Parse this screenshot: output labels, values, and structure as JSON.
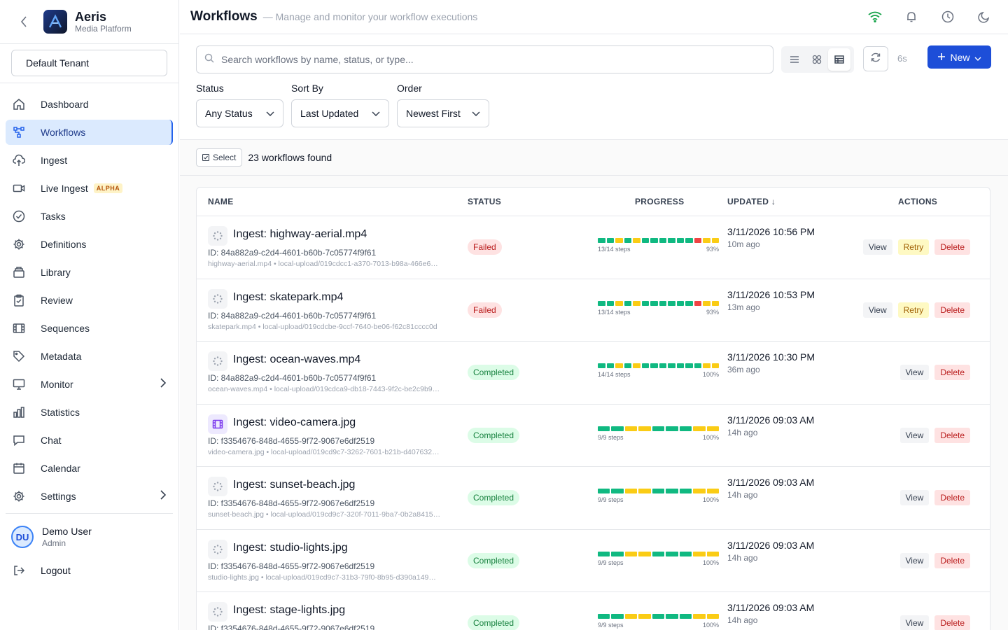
{
  "brand": {
    "name": "Aeris",
    "subtitle": "Media Platform"
  },
  "tenant": "Default Tenant",
  "nav": [
    {
      "label": "Dashboard",
      "icon": "home-icon",
      "active": false
    },
    {
      "label": "Workflows",
      "icon": "workflow-icon",
      "active": true
    },
    {
      "label": "Ingest",
      "icon": "cloud-upload-icon",
      "active": false
    },
    {
      "label": "Live Ingest",
      "icon": "video-icon",
      "active": false,
      "badge": "ALPHA"
    },
    {
      "label": "Tasks",
      "icon": "check-circle-icon",
      "active": false
    },
    {
      "label": "Definitions",
      "icon": "gear-icon",
      "active": false
    },
    {
      "label": "Library",
      "icon": "archive-icon",
      "active": false
    },
    {
      "label": "Review",
      "icon": "clipboard-check-icon",
      "active": false
    },
    {
      "label": "Sequences",
      "icon": "film-icon",
      "active": false
    },
    {
      "label": "Metadata",
      "icon": "tag-icon",
      "active": false
    },
    {
      "label": "Monitor",
      "icon": "monitor-icon",
      "active": false,
      "expandable": true
    },
    {
      "label": "Statistics",
      "icon": "bar-chart-icon",
      "active": false
    },
    {
      "label": "Chat",
      "icon": "chat-icon",
      "active": false
    },
    {
      "label": "Calendar",
      "icon": "calendar-icon",
      "active": false
    },
    {
      "label": "Settings",
      "icon": "gear-icon",
      "active": false,
      "expandable": true
    }
  ],
  "user": {
    "initials": "DU",
    "name": "Demo User",
    "role": "Admin"
  },
  "logout": "Logout",
  "header": {
    "title": "Workflows",
    "subtitle": "— Manage and monitor your workflow executions"
  },
  "search": {
    "placeholder": "Search workflows by name, status, or type..."
  },
  "refresh_interval": "6s",
  "new_button": "New",
  "filters": {
    "status": {
      "label": "Status",
      "value": "Any Status"
    },
    "sort": {
      "label": "Sort By",
      "value": "Last Updated"
    },
    "order": {
      "label": "Order",
      "value": "Newest First"
    }
  },
  "results": {
    "select_label": "Select",
    "count_text": "23 workflows found"
  },
  "columns": {
    "name": "NAME",
    "status": "STATUS",
    "progress": "PROGRESS",
    "updated": "UPDATED ↓",
    "actions": "ACTIONS"
  },
  "colors": {
    "success": "#10b981",
    "pending": "#facc15",
    "error": "#ef4444",
    "accent": "#1d4ed8"
  },
  "workflows": [
    {
      "icon": "spinner-icon",
      "title": "Ingest: highway-aerial.mp4",
      "id": "ID: 84a882a9-c2d4-4601-b60b-7c05774f9f61",
      "source": "highway-aerial.mp4  • local-upload/019cdcc1-a370-7013-b98a-466e6…",
      "status": "Failed",
      "steps_text": "13/14 steps",
      "percent_text": "93%",
      "segments": [
        "g",
        "g",
        "y",
        "g",
        "y",
        "g",
        "g",
        "g",
        "g",
        "g",
        "g",
        "r",
        "y",
        "y"
      ],
      "date": "3/11/2026 10:56 PM",
      "ago": "10m ago",
      "actions": [
        "View",
        "Retry",
        "Delete"
      ]
    },
    {
      "icon": "spinner-icon",
      "title": "Ingest: skatepark.mp4",
      "id": "ID: 84a882a9-c2d4-4601-b60b-7c05774f9f61",
      "source": "skatepark.mp4  • local-upload/019cdcbe-9ccf-7640-be06-f62c81cccc0d",
      "status": "Failed",
      "steps_text": "13/14 steps",
      "percent_text": "93%",
      "segments": [
        "g",
        "g",
        "y",
        "g",
        "y",
        "g",
        "g",
        "g",
        "g",
        "g",
        "g",
        "r",
        "y",
        "y"
      ],
      "date": "3/11/2026 10:53 PM",
      "ago": "13m ago",
      "actions": [
        "View",
        "Retry",
        "Delete"
      ]
    },
    {
      "icon": "spinner-icon",
      "title": "Ingest: ocean-waves.mp4",
      "id": "ID: 84a882a9-c2d4-4601-b60b-7c05774f9f61",
      "source": "ocean-waves.mp4  • local-upload/019cdca9-db18-7443-9f2c-be2c9b9…",
      "status": "Completed",
      "steps_text": "14/14 steps",
      "percent_text": "100%",
      "segments": [
        "g",
        "g",
        "y",
        "g",
        "y",
        "g",
        "g",
        "g",
        "g",
        "g",
        "g",
        "g",
        "y",
        "y"
      ],
      "date": "3/11/2026 10:30 PM",
      "ago": "36m ago",
      "actions": [
        "View",
        "Delete"
      ]
    },
    {
      "icon": "film-icon",
      "title": "Ingest: video-camera.jpg",
      "id": "ID: f3354676-848d-4655-9f72-9067e6df2519",
      "source": "video-camera.jpg  • local-upload/019cd9c7-3262-7601-b21b-d407632…",
      "status": "Completed",
      "steps_text": "9/9 steps",
      "percent_text": "100%",
      "segments": [
        "g",
        "g",
        "y",
        "y",
        "g",
        "g",
        "g",
        "y",
        "y"
      ],
      "date": "3/11/2026 09:03 AM",
      "ago": "14h ago",
      "actions": [
        "View",
        "Delete"
      ]
    },
    {
      "icon": "spinner-icon",
      "title": "Ingest: sunset-beach.jpg",
      "id": "ID: f3354676-848d-4655-9f72-9067e6df2519",
      "source": "sunset-beach.jpg  • local-upload/019cd9c7-320f-7011-9ba7-0b2a8415…",
      "status": "Completed",
      "steps_text": "9/9 steps",
      "percent_text": "100%",
      "segments": [
        "g",
        "g",
        "y",
        "y",
        "g",
        "g",
        "g",
        "y",
        "y"
      ],
      "date": "3/11/2026 09:03 AM",
      "ago": "14h ago",
      "actions": [
        "View",
        "Delete"
      ]
    },
    {
      "icon": "spinner-icon",
      "title": "Ingest: studio-lights.jpg",
      "id": "ID: f3354676-848d-4655-9f72-9067e6df2519",
      "source": "studio-lights.jpg  • local-upload/019cd9c7-31b3-79f0-8b95-d390a149…",
      "status": "Completed",
      "steps_text": "9/9 steps",
      "percent_text": "100%",
      "segments": [
        "g",
        "g",
        "y",
        "y",
        "g",
        "g",
        "g",
        "y",
        "y"
      ],
      "date": "3/11/2026 09:03 AM",
      "ago": "14h ago",
      "actions": [
        "View",
        "Delete"
      ]
    },
    {
      "icon": "spinner-icon",
      "title": "Ingest: stage-lights.jpg",
      "id": "ID: f3354676-848d-4655-9f72-9067e6df2519",
      "source": "",
      "status": "Completed",
      "steps_text": "9/9 steps",
      "percent_text": "100%",
      "segments": [
        "g",
        "g",
        "y",
        "y",
        "g",
        "g",
        "g",
        "y",
        "y"
      ],
      "date": "3/11/2026 09:03 AM",
      "ago": "14h ago",
      "actions": [
        "View",
        "Delete"
      ]
    }
  ]
}
